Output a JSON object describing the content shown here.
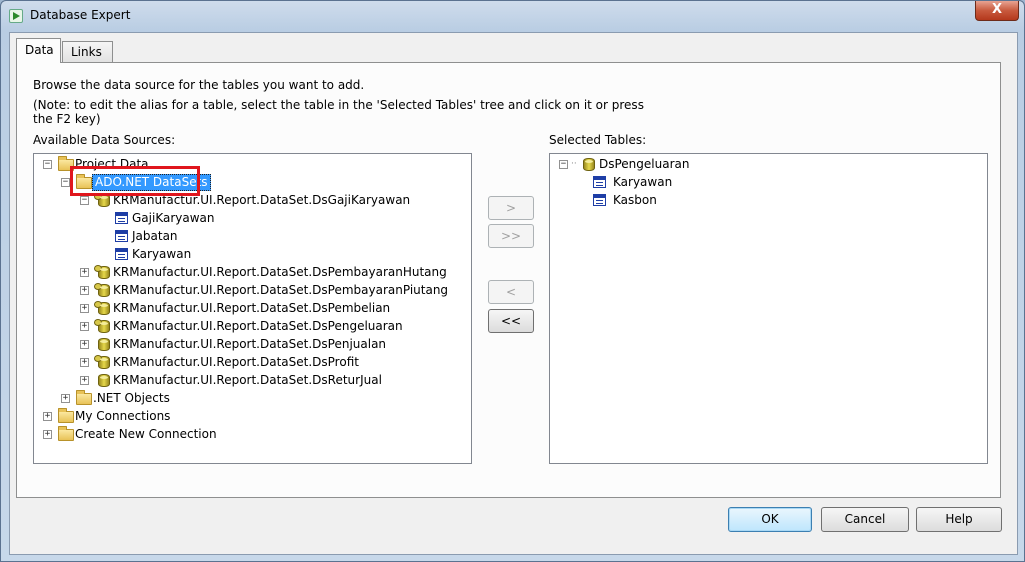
{
  "window": {
    "title": "Database Expert",
    "close_glyph": "X"
  },
  "tabs": [
    {
      "label": "Data",
      "active": true
    },
    {
      "label": "Links",
      "active": false
    }
  ],
  "instructions": {
    "line1": "Browse the data source for the tables you want to add.",
    "line2": "(Note: to edit the alias for a table, select the table in the 'Selected Tables' tree and click on it or press",
    "line3": "the F2 key)"
  },
  "available": {
    "label": "Available Data Sources:",
    "tree": {
      "project_data": "Project Data",
      "ado_net": "ADO.NET DataSets",
      "ds_gaji": "KRManufactur.UI.Report.DataSet.DsGajiKaryawan",
      "ds_gaji_tables": [
        "GajiKaryawan",
        "Jabatan",
        "Karyawan"
      ],
      "datasets": [
        "KRManufactur.UI.Report.DataSet.DsPembayaranHutang",
        "KRManufactur.UI.Report.DataSet.DsPembayaranPiutang",
        "KRManufactur.UI.Report.DataSet.DsPembelian",
        "KRManufactur.UI.Report.DataSet.DsPengeluaran",
        "KRManufactur.UI.Report.DataSet.DsPenjualan",
        "KRManufactur.UI.Report.DataSet.DsProfit",
        "KRManufactur.UI.Report.DataSet.DsReturJual"
      ],
      "net_objects": ".NET Objects",
      "my_connections": "My Connections",
      "create_new": "Create New Connection"
    }
  },
  "selected": {
    "label": "Selected Tables:",
    "dataset": "DsPengeluaran",
    "tables": [
      "Karyawan",
      "Kasbon"
    ]
  },
  "transfer_buttons": {
    "add": ">",
    "add_all": ">>",
    "remove": "<",
    "remove_all": "<<"
  },
  "footer": {
    "ok": "OK",
    "cancel": "Cancel",
    "help": "Help"
  },
  "icons": {
    "folder": "folder-icon",
    "dataset": "database-icon",
    "table": "table-icon",
    "expand": "plus-box-icon",
    "collapse": "minus-box-icon"
  },
  "colors": {
    "selection": "#3399ff",
    "highlight_box": "#e0161d",
    "table_icon": "#1e3ea6"
  }
}
